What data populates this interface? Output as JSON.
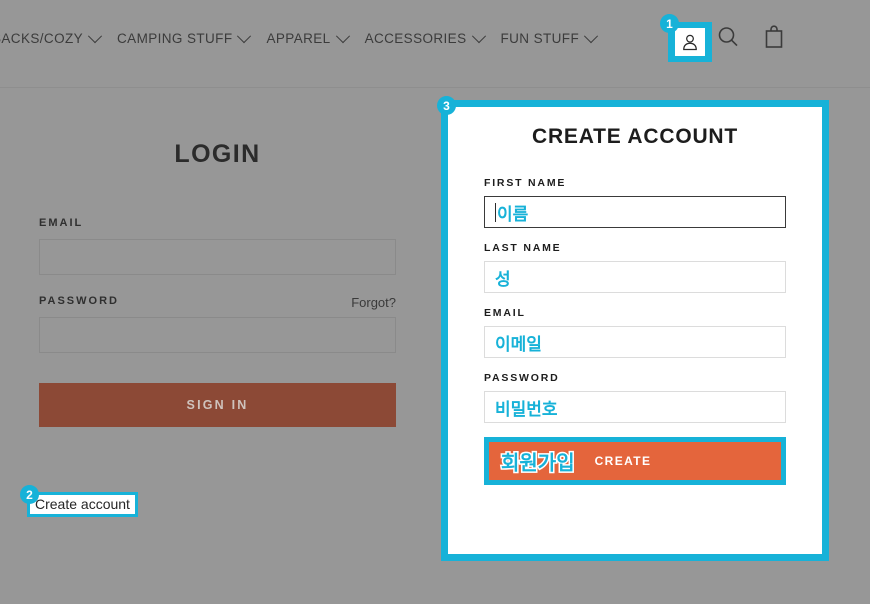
{
  "header": {
    "nav_items": [
      {
        "label": "SACKS/COZY",
        "caret": "chevron-down-icon"
      },
      {
        "label": "CAMPING STUFF",
        "caret": "chevron-down-icon"
      },
      {
        "label": "APPAREL",
        "caret": "chevron-down-icon"
      },
      {
        "label": "ACCESSORIES",
        "caret": "chevron-down-icon"
      },
      {
        "label": "FUN STUFF",
        "caret": "chevron-down-icon"
      }
    ],
    "icons": [
      {
        "name": "account-person-icon"
      },
      {
        "name": "search-icon"
      },
      {
        "name": "shopping-bag-icon"
      }
    ]
  },
  "annotations": {
    "badge_1": "1",
    "badge_2": "2",
    "badge_3": "3",
    "highlight_color": "#17b2d8"
  },
  "login": {
    "title": "LOGIN",
    "email_label": "EMAIL",
    "email_value": "",
    "email_placeholder": "",
    "password_label": "PASSWORD",
    "password_value": "",
    "password_placeholder": "",
    "forgot_label": "Forgot?",
    "signin_label": "SIGN IN",
    "create_account_label": "Create account",
    "button_color": "#8c4936"
  },
  "create_account_modal": {
    "title": "CREATE ACCOUNT",
    "first_name_label": "FIRST NAME",
    "first_name_value": "이름",
    "last_name_label": "LAST NAME",
    "last_name_value": "성",
    "email_label": "EMAIL",
    "email_value": "이메일",
    "password_label": "PASSWORD",
    "password_value": "비밀번호",
    "create_button_korean": "회원가입",
    "create_button_label": "CREATE",
    "create_button_color": "#e4653c",
    "field_text_color": "#17b2d8"
  }
}
